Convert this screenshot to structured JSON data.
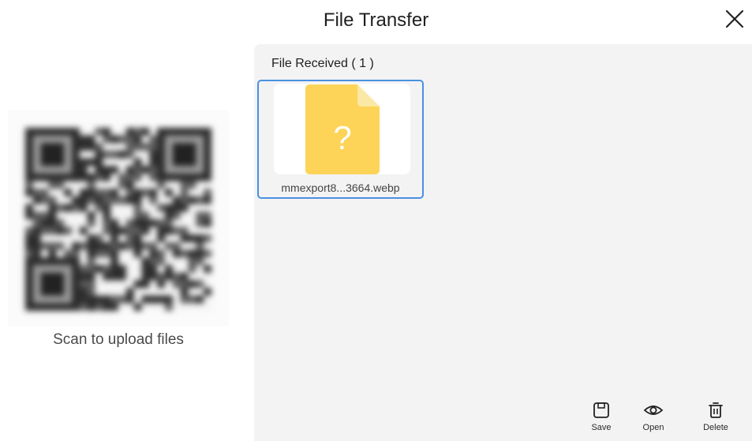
{
  "title": "File Transfer",
  "qr": {
    "caption": "Scan to upload files"
  },
  "received": {
    "header": "File Received ( 1 )",
    "files": [
      {
        "name": "mmexport8...3664.webp",
        "icon": "unknown-file-icon",
        "icon_color": "#FDD458"
      }
    ]
  },
  "actions": {
    "save": "Save",
    "open": "Open",
    "delete": "Delete"
  },
  "colors": {
    "accent": "#4A90E2",
    "panel_bg": "#F3F3F3",
    "file_icon": "#FDD458"
  }
}
